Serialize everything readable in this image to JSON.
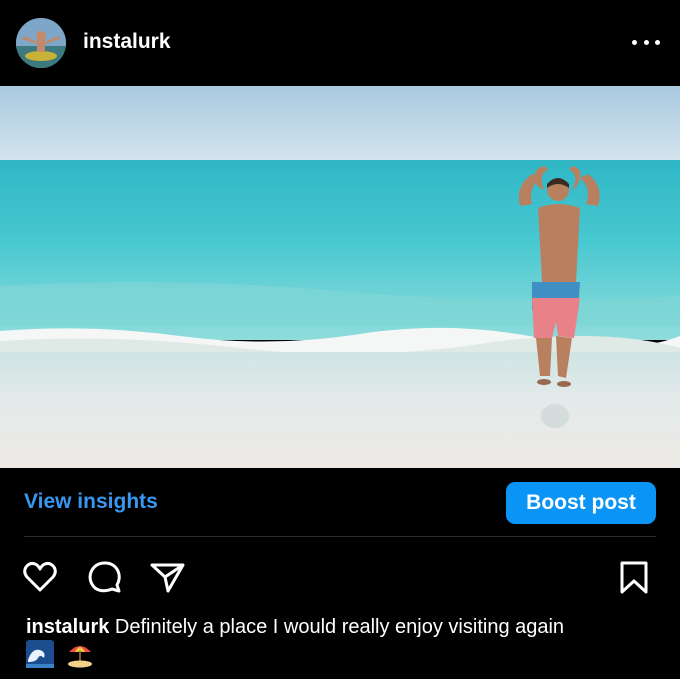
{
  "post": {
    "username": "instalurk",
    "more_icon": "more-horizontal-icon"
  },
  "insights": {
    "view_label": "View insights",
    "boost_label": "Boost post"
  },
  "actions": {
    "icons": [
      "heart-icon",
      "comment-icon",
      "share-icon",
      "bookmark-icon"
    ]
  },
  "caption": {
    "username": "instalurk",
    "text": "Definitely a place I would really enjoy visiting again",
    "emojis": [
      "wave-emoji",
      "beach-umbrella-emoji"
    ]
  },
  "colors": {
    "accent": "#3897f0",
    "button": "#0a95f6",
    "background": "#000000"
  }
}
